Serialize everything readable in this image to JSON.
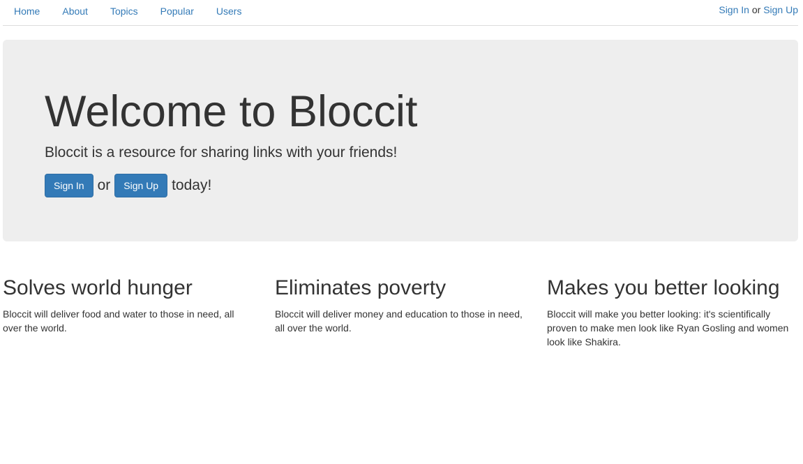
{
  "nav": {
    "items": [
      {
        "label": "Home"
      },
      {
        "label": "About"
      },
      {
        "label": "Topics"
      },
      {
        "label": "Popular"
      },
      {
        "label": "Users"
      }
    ],
    "auth": {
      "sign_in": "Sign In",
      "or": "or",
      "sign_up": "Sign Up"
    }
  },
  "jumbotron": {
    "title": "Welcome to Bloccit",
    "lead": "Bloccit is a resource for sharing links with your friends!",
    "sign_in_button": "Sign In",
    "or": "or",
    "sign_up_button": "Sign Up",
    "today": "today!"
  },
  "features": [
    {
      "heading": "Solves world hunger",
      "text": "Bloccit will deliver food and water to those in need, all over the world."
    },
    {
      "heading": "Eliminates poverty",
      "text": "Bloccit will deliver money and education to those in need, all over the world."
    },
    {
      "heading": "Makes you better looking",
      "text": "Bloccit will make you better looking: it's scientifically proven to make men look like Ryan Gosling and women look like Shakira."
    }
  ],
  "colors": {
    "link": "#337ab7",
    "primary_button": "#337ab7",
    "jumbotron_bg": "#eeeeee",
    "text": "#333333"
  }
}
